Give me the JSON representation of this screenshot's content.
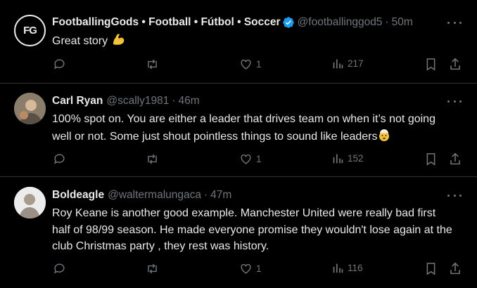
{
  "tweets": [
    {
      "avatar_text": "FG",
      "name": "FootballingGods • Football • Fútbol • Soccer",
      "handle": "@footballinggod5",
      "separator": "·",
      "time": "50m",
      "text": "Great story",
      "emoji": "flexed-biceps",
      "replies": "",
      "retweets": "",
      "likes": "1",
      "views": "217"
    },
    {
      "name": "Carl Ryan",
      "handle": "@scally1981",
      "separator": "·",
      "time": "46m",
      "text": "100% spot on. You are either a leader that drives team on when it’s not going well or not. Some just shout pointless things to sound like leaders",
      "emoji": "exploding-head",
      "replies": "",
      "retweets": "",
      "likes": "1",
      "views": "152"
    },
    {
      "name": "Boldeagle",
      "handle": "@waltermalungaca",
      "separator": "·",
      "time": "47m",
      "text": "Roy Keane is another good example. Manchester United were really bad first half of 98/99 season. He made everyone promise they wouldn't lose again at the club Christmas party , they rest was history.",
      "replies": "",
      "retweets": "",
      "likes": "1",
      "views": "116"
    }
  ],
  "colors": {
    "background": "#000000",
    "text": "#e7e9ea",
    "muted": "#71767b",
    "border": "#2f3336",
    "verified": "#1d9bf0"
  }
}
